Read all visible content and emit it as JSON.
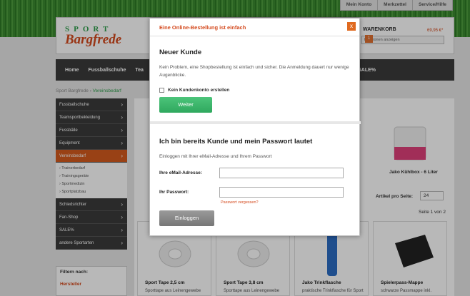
{
  "topbar": {
    "account": "Mein Konto",
    "wishlist": "Merkzettel",
    "service": "Service/Hilfe"
  },
  "logo": {
    "sport": "SPORT",
    "name": "Bargfrede"
  },
  "cart": {
    "title": "WARENKORB",
    "price": "69,95 €*",
    "select": "Positionen anzeigen",
    "count": "1"
  },
  "nav": [
    "Home",
    "Fussballschuhe",
    "Tea",
    "SALE%"
  ],
  "breadcrumb": {
    "home": "Sport Bargfrede",
    "current": "Vereinsbedarf"
  },
  "sidebar": {
    "items": [
      "Fussballschuhe",
      "Teamsportbekleidung",
      "Fussbälle",
      "Equipment",
      "Vereinsbedarf"
    ],
    "sub": [
      "Trainerbedarf",
      "Trainingsgeräte",
      "Sportmedizin",
      "Sportplatzbau"
    ],
    "items2": [
      "Schiedsrichter",
      "Fan-Shop",
      "SALE%",
      "andere Sportarten"
    ]
  },
  "filter": {
    "title": "Filtern nach:",
    "manufacturer": "Hersteller"
  },
  "listing": {
    "per_page_label": "Artikel pro Seite:",
    "per_page": "24",
    "page": "Seite 1 von 2",
    "kuehlbox": "Jako Kühlbox - 6 Liter"
  },
  "products": [
    {
      "title": "Sport Tape 2,5 cm",
      "desc": "Sporttape aus Leinengewebe"
    },
    {
      "title": "Sport Tape 3,8 cm",
      "desc": "Sporttape aus Leinengewebe"
    },
    {
      "title": "Jako Trinkflasche",
      "desc": "praktische Trinkflasche für Sport"
    },
    {
      "title": "Spielerpass-Mappe",
      "desc": "schwarze Passmappe inkl."
    }
  ],
  "modal": {
    "title": "Eine Online-Bestellung ist einfach",
    "close": "x",
    "new_customer": "Neuer Kunde",
    "new_text": "Kein Problem, eine Shopbestellung ist einfach und sicher. Die Anmeldung dauert nur wenige Augenblicke.",
    "no_account": "Kein Kundenkonto erstellen",
    "continue": "Weiter",
    "existing": "Ich bin bereits Kunde und mein Passwort lautet",
    "login_text": "Einloggen mit Ihrer eMail-Adresse und Ihrem Passwort",
    "email_label": "Ihre eMail-Adresse:",
    "password_label": "Ihr Passwort:",
    "forgot": "Passwort vergessen?",
    "login": "Einloggen"
  }
}
